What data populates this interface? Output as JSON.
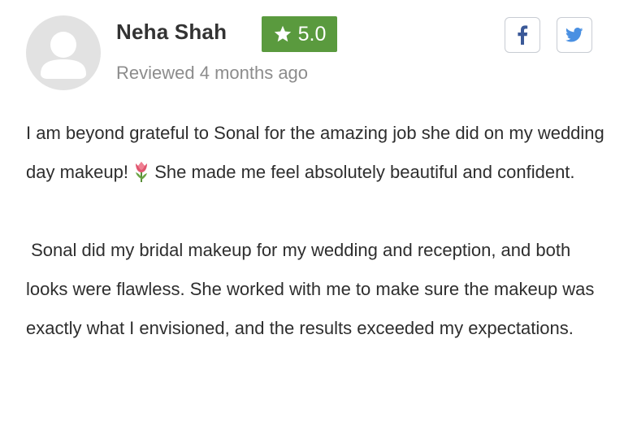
{
  "reviewer": {
    "name": "Neha Shah",
    "rating": "5.0",
    "meta": "Reviewed 4 months ago"
  },
  "share": {
    "facebook_icon": "facebook-icon",
    "twitter_icon": "twitter-icon"
  },
  "review": {
    "paragraph1_part1": "I am beyond grateful to Sonal for the amazing job she did on my wedding day makeup! ",
    "emoji": "tulip-icon",
    "paragraph1_part2": " She made me feel absolutely beautiful and confident.",
    "paragraph2": " Sonal did my bridal makeup for my wedding and reception, and both looks were flawless. She worked with me to make sure the makeup was exactly what I envisioned, and the results exceeded my expectations."
  },
  "colors": {
    "rating_badge": "#5a9a3e",
    "twitter_blue": "#4a90e2",
    "facebook_blue": "#3b5998",
    "meta_gray": "#8c8c8c",
    "avatar_bg": "#e2e2e2"
  }
}
